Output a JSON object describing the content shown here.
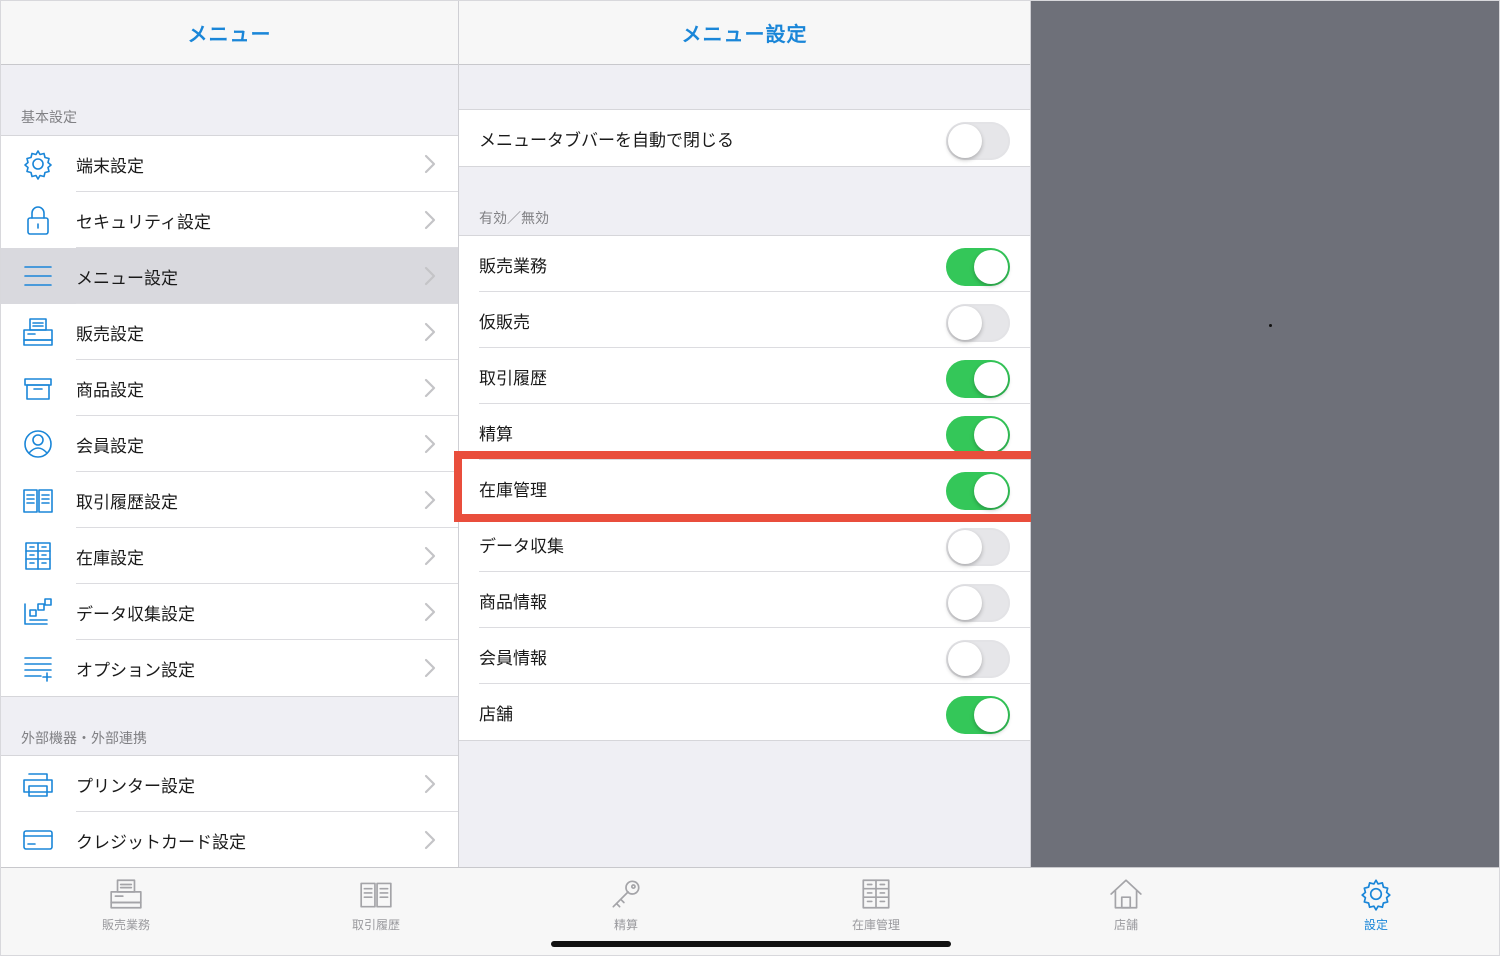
{
  "colors": {
    "accent": "#1a86d8",
    "toggle_on": "#34c759",
    "highlight": "#e94e3c",
    "detail_bg": "#6e7079"
  },
  "left": {
    "title": "メニュー",
    "basic_section": "基本設定",
    "basic_items": [
      {
        "label": "端末設定",
        "icon": "gear-icon"
      },
      {
        "label": "セキュリティ設定",
        "icon": "lock-icon"
      },
      {
        "label": "メニュー設定",
        "icon": "menu-lines-icon",
        "selected": true
      },
      {
        "label": "販売設定",
        "icon": "register-icon"
      },
      {
        "label": "商品設定",
        "icon": "box-icon"
      },
      {
        "label": "会員設定",
        "icon": "person-icon"
      },
      {
        "label": "取引履歴設定",
        "icon": "book-icon"
      },
      {
        "label": "在庫設定",
        "icon": "cabinet-icon"
      },
      {
        "label": "データ収集設定",
        "icon": "data-collect-icon"
      },
      {
        "label": "オプション設定",
        "icon": "list-plus-icon"
      }
    ],
    "external_section": "外部機器・外部連携",
    "external_items": [
      {
        "label": "プリンター設定",
        "icon": "printer-icon"
      },
      {
        "label": "クレジットカード設定",
        "icon": "credit-card-icon"
      }
    ]
  },
  "middle": {
    "title": "メニュー設定",
    "auto_close_label": "メニュータブバーを自動で閉じる",
    "auto_close_on": false,
    "section": "有効／無効",
    "toggles": [
      {
        "label": "販売業務",
        "on": true
      },
      {
        "label": "仮販売",
        "on": false
      },
      {
        "label": "取引履歴",
        "on": true
      },
      {
        "label": "精算",
        "on": true
      },
      {
        "label": "在庫管理",
        "on": true
      },
      {
        "label": "データ収集",
        "on": false
      },
      {
        "label": "商品情報",
        "on": false
      },
      {
        "label": "会員情報",
        "on": false
      },
      {
        "label": "店舗",
        "on": true
      }
    ]
  },
  "tabs": [
    {
      "label": "販売業務",
      "icon": "register-icon",
      "active": false
    },
    {
      "label": "取引履歴",
      "icon": "book-icon",
      "active": false
    },
    {
      "label": "精算",
      "icon": "key-icon",
      "active": false
    },
    {
      "label": "在庫管理",
      "icon": "cabinet-icon",
      "active": false
    },
    {
      "label": "店舗",
      "icon": "house-icon",
      "active": false
    },
    {
      "label": "設定",
      "icon": "gear-icon",
      "active": true
    }
  ]
}
